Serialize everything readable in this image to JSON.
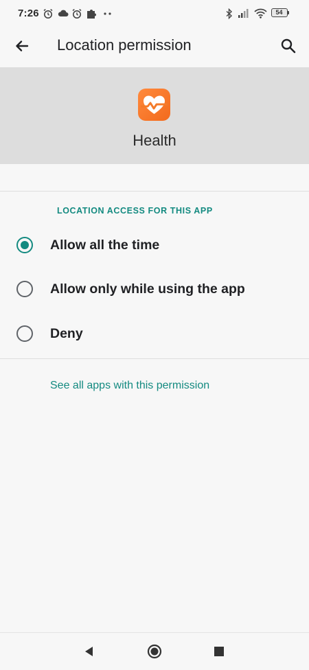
{
  "status_bar": {
    "time": "7:26",
    "battery_level": "54",
    "left_icons": [
      "alarm-icon",
      "cloud-icon",
      "alarm-icon",
      "puzzle-icon",
      "more-dots-icon"
    ],
    "right_icons": [
      "bluetooth-icon",
      "signal-icon",
      "wifi-icon",
      "battery-icon"
    ]
  },
  "app_bar": {
    "title": "Location permission",
    "back_icon": "arrow-back-icon",
    "search_icon": "search-icon"
  },
  "app": {
    "name": "Health",
    "icon": "health-heart-icon",
    "icon_color": "#f47b2a"
  },
  "section": {
    "title": "LOCATION ACCESS FOR THIS APP"
  },
  "options": [
    {
      "label": "Allow all the time",
      "selected": true
    },
    {
      "label": "Allow only while using the app",
      "selected": false
    },
    {
      "label": "Deny",
      "selected": false
    }
  ],
  "link": {
    "label": "See all apps with this permission"
  },
  "colors": {
    "accent": "#138a80",
    "header_bg": "#dddddd",
    "page_bg": "#f7f7f7"
  },
  "nav_bar": {
    "buttons": [
      "back-triangle-icon",
      "home-circle-icon",
      "recents-square-icon"
    ]
  }
}
